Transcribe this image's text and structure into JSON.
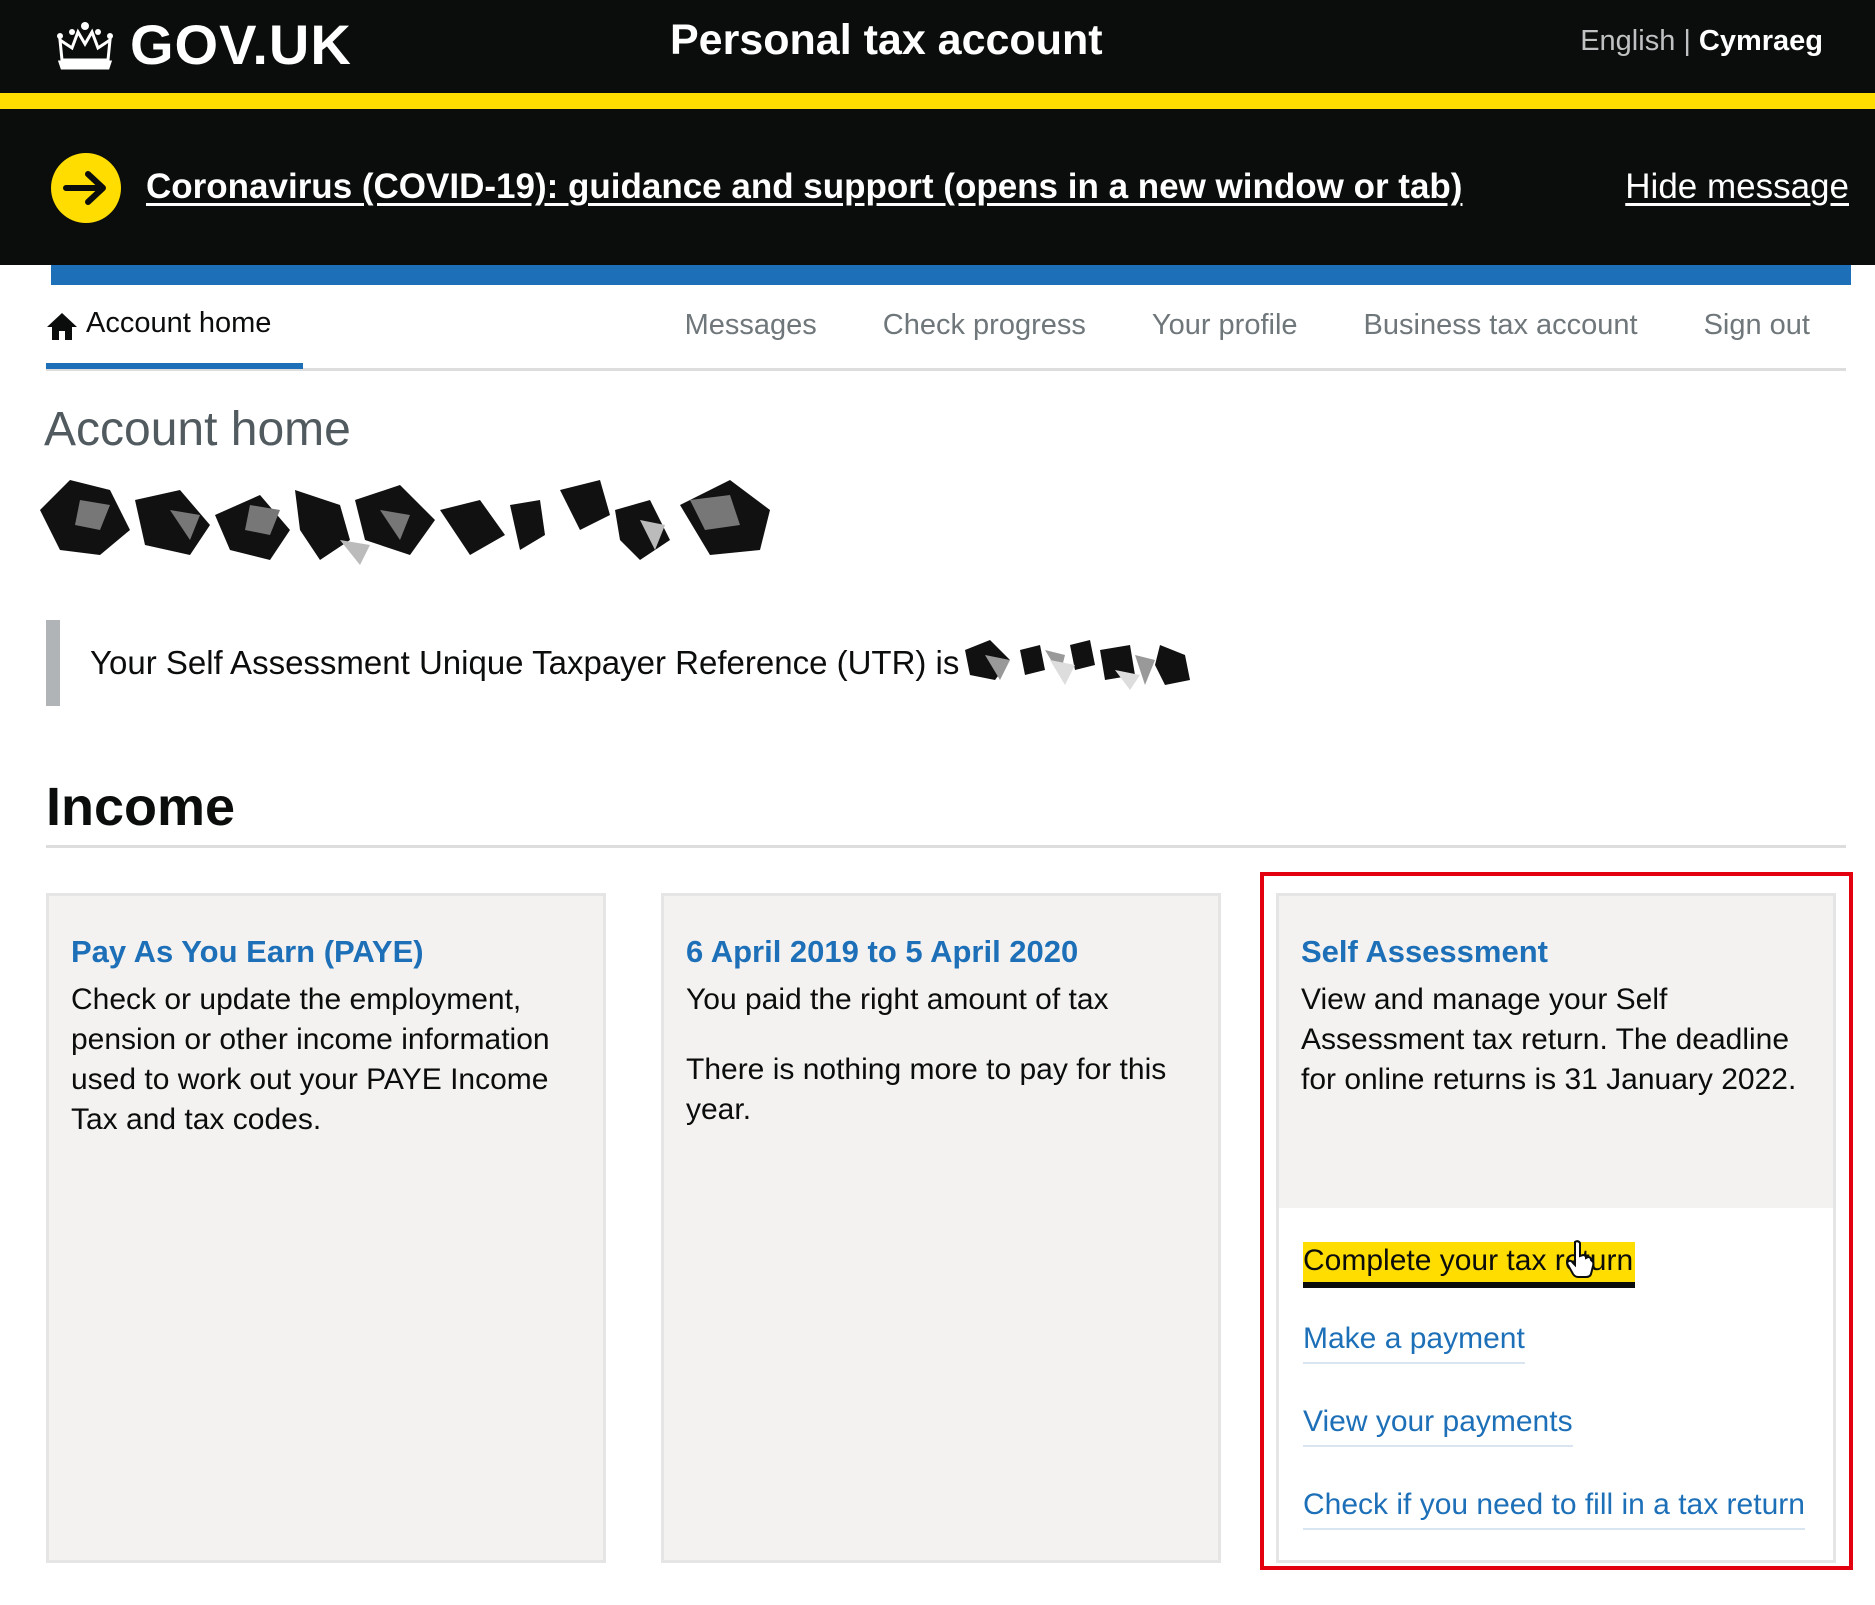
{
  "header": {
    "logo_text": "GOV.UK",
    "service_name": "Personal tax account",
    "lang_english": "English",
    "lang_separator": "|",
    "lang_welsh": "Cymraeg"
  },
  "banner": {
    "link_text": "Coronavirus (COVID-19): guidance and support (opens in a new window or tab)",
    "hide_text": "Hide message"
  },
  "nav": {
    "home": "Account home",
    "items": [
      "Messages",
      "Check progress",
      "Your profile",
      "Business tax account",
      "Sign out"
    ]
  },
  "page": {
    "title": "Account home",
    "utr_text": "Your Self Assessment Unique Taxpayer Reference (UTR) is",
    "section_heading": "Income"
  },
  "cards": [
    {
      "title": "Pay As You Earn (PAYE)",
      "text": [
        "Check or update the employment, pension or other income information used to work out your PAYE Income Tax and tax codes."
      ]
    },
    {
      "title": "6 April 2019 to 5 April 2020",
      "text": [
        "You paid the right amount of tax",
        "There is nothing more to pay for this year."
      ]
    },
    {
      "title": "Self Assessment",
      "text": [
        "View and manage your Self Assessment tax return. The deadline for online returns is 31 January 2022."
      ],
      "cta": "Complete your tax return",
      "links": [
        "Make a payment",
        "View your payments",
        "Check if you need to fill in a tax return"
      ]
    }
  ],
  "colors": {
    "header_bg": "#0b0c0c",
    "stripe": "#ffdd00",
    "link_blue": "#1d70b8",
    "highlight_red": "#e3000f"
  }
}
